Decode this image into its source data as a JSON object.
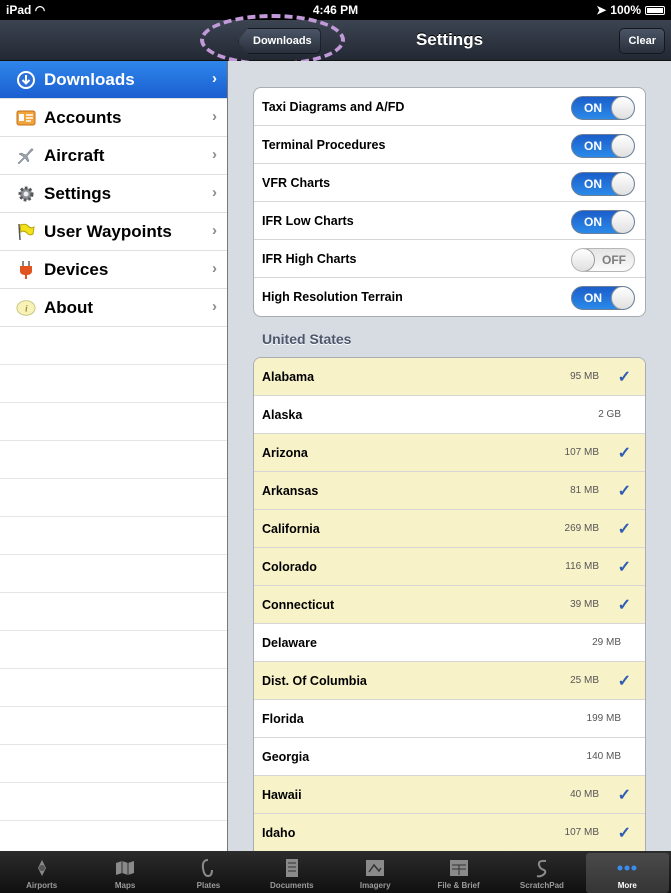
{
  "status": {
    "carrier": "iPad",
    "time": "4:46 PM",
    "battery": "100%"
  },
  "nav": {
    "back_label": "Downloads",
    "title": "Settings",
    "clear_label": "Clear"
  },
  "sidebar": {
    "items": [
      {
        "label": "Downloads",
        "icon": "download-icon",
        "active": true
      },
      {
        "label": "Accounts",
        "icon": "accounts-card-icon"
      },
      {
        "label": "Aircraft",
        "icon": "airplane-icon"
      },
      {
        "label": "Settings",
        "icon": "gear-icon"
      },
      {
        "label": "User Waypoints",
        "icon": "flag-icon"
      },
      {
        "label": "Devices",
        "icon": "plug-icon"
      },
      {
        "label": "About",
        "icon": "info-icon"
      }
    ]
  },
  "toggles": [
    {
      "label": "Taxi Diagrams and A/FD",
      "state": "ON"
    },
    {
      "label": "Terminal Procedures",
      "state": "ON"
    },
    {
      "label": "VFR Charts",
      "state": "ON"
    },
    {
      "label": "IFR Low Charts",
      "state": "ON"
    },
    {
      "label": "IFR High Charts",
      "state": "OFF"
    },
    {
      "label": "High Resolution Terrain",
      "state": "ON"
    }
  ],
  "section_title": "United States",
  "states": [
    {
      "name": "Alabama",
      "size": "95 MB",
      "selected": true
    },
    {
      "name": "Alaska",
      "size": "2 GB",
      "selected": false
    },
    {
      "name": "Arizona",
      "size": "107 MB",
      "selected": true
    },
    {
      "name": "Arkansas",
      "size": "81 MB",
      "selected": true
    },
    {
      "name": "California",
      "size": "269 MB",
      "selected": true
    },
    {
      "name": "Colorado",
      "size": "116 MB",
      "selected": true
    },
    {
      "name": "Connecticut",
      "size": "39 MB",
      "selected": true
    },
    {
      "name": "Delaware",
      "size": "29 MB",
      "selected": false
    },
    {
      "name": "Dist. Of Columbia",
      "size": "25 MB",
      "selected": true
    },
    {
      "name": "Florida",
      "size": "199 MB",
      "selected": false
    },
    {
      "name": "Georgia",
      "size": "140 MB",
      "selected": false
    },
    {
      "name": "Hawaii",
      "size": "40 MB",
      "selected": true
    },
    {
      "name": "Idaho",
      "size": "107 MB",
      "selected": true
    }
  ],
  "tabs": [
    {
      "label": "Airports",
      "icon": "airports-icon"
    },
    {
      "label": "Maps",
      "icon": "maps-icon"
    },
    {
      "label": "Plates",
      "icon": "plates-icon"
    },
    {
      "label": "Documents",
      "icon": "documents-icon"
    },
    {
      "label": "Imagery",
      "icon": "imagery-icon"
    },
    {
      "label": "File & Brief",
      "icon": "file-brief-icon"
    },
    {
      "label": "ScratchPad",
      "icon": "scratchpad-icon"
    },
    {
      "label": "More",
      "icon": "more-dots-icon",
      "active": true
    }
  ],
  "colors": {
    "accent": "#1a5fd1",
    "selected_row": "#f8f2c9",
    "switch_on": "#2b8ae8",
    "highlight_ring": "#c39ad9"
  }
}
